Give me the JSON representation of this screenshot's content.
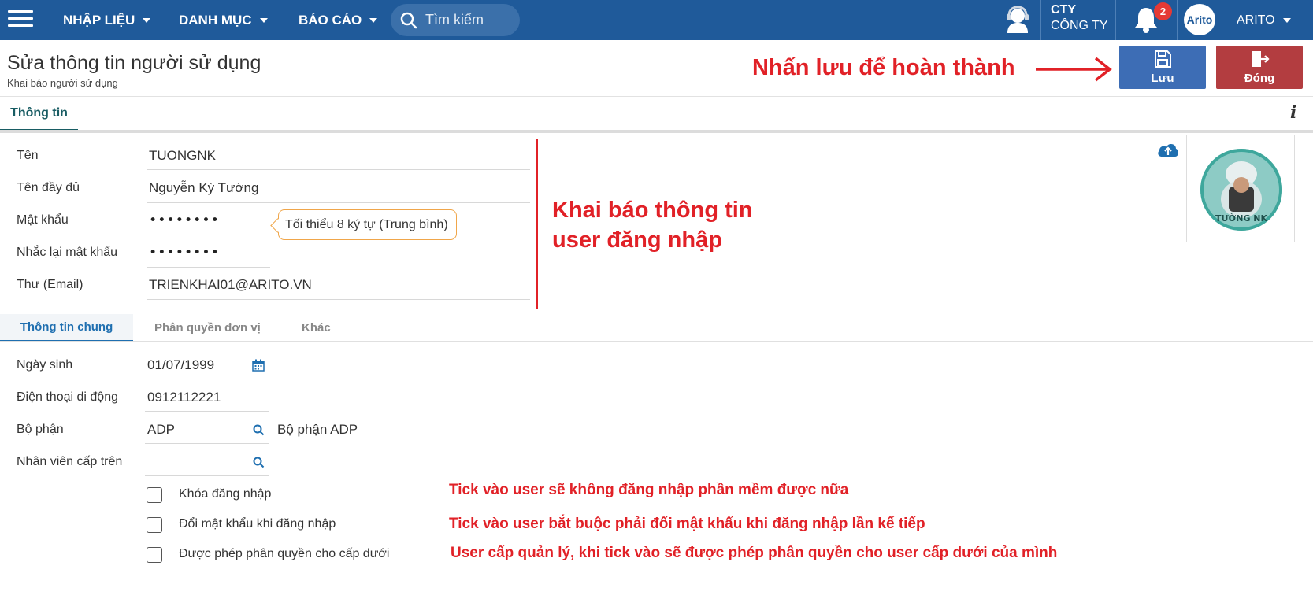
{
  "topbar": {
    "menus": [
      "NHẬP LIỆU",
      "DANH MỤC",
      "BÁO CÁO"
    ],
    "search_placeholder": "Tìm kiếm",
    "company_short": "CTY",
    "company_name": "CÔNG TY",
    "notification_count": "2",
    "logo_text": "Arito",
    "user": "ARITO"
  },
  "header": {
    "title": "Sửa thông tin người sử dụng",
    "subtitle": "Khai báo người sử dụng",
    "save_label": "Lưu",
    "close_label": "Đóng"
  },
  "annotations": {
    "save_hint": "Nhấn lưu để hoàn thành",
    "user_info_line1": "Khai báo thông tin",
    "user_info_line2": "user đăng nhập",
    "lock_hint": "Tick vào user sẽ không đăng nhập phần mềm được nữa",
    "change_pw_hint": "Tick vào user bắt buộc phải đổi mật khẩu khi đăng nhập lần kế tiếp",
    "delegate_hint": "User cấp quản lý, khi tick vào sẽ được phép phân quyền cho user cấp dưới của mình"
  },
  "tabs": {
    "main": "Thông tin",
    "info_icon": "i"
  },
  "form": {
    "name_label": "Tên",
    "name_value": "TUONGNK",
    "fullname_label": "Tên đầy đủ",
    "fullname_value": "Nguyễn Kỳ Tường",
    "password_label": "Mật khẩu",
    "password_value": "••••••••",
    "password_hint": "Tối thiểu 8 ký tự (Trung bình)",
    "repeat_label": "Nhắc lại mật khẩu",
    "repeat_value": "••••••••",
    "email_label": "Thư (Email)",
    "email_value": "TRIENKHAI01@ARITO.VN"
  },
  "avatar_text": "TƯỜNG NK",
  "subtabs": [
    "Thông tin chung",
    "Phân quyền đơn vị",
    "Khác"
  ],
  "general": {
    "birth_label": "Ngày sinh",
    "birth_value": "01/07/1999",
    "phone_label": "Điện thoại di động",
    "phone_value": "0912112221",
    "dept_label": "Bộ phận",
    "dept_value": "ADP",
    "dept_name": "Bộ phận ADP",
    "manager_label": "Nhân viên cấp trên",
    "manager_value": ""
  },
  "checkboxes": [
    {
      "label": "Khóa đăng nhập",
      "checked": false
    },
    {
      "label": "Đổi mật khẩu khi đăng nhập",
      "checked": false
    },
    {
      "label": "Được phép phân quyền cho cấp dưới",
      "checked": false
    }
  ],
  "colors": {
    "topbar": "#1f5a9a",
    "save": "#3d6db5",
    "close": "#b33d40",
    "annotation": "#e12127",
    "tab_active": "#185c63"
  }
}
